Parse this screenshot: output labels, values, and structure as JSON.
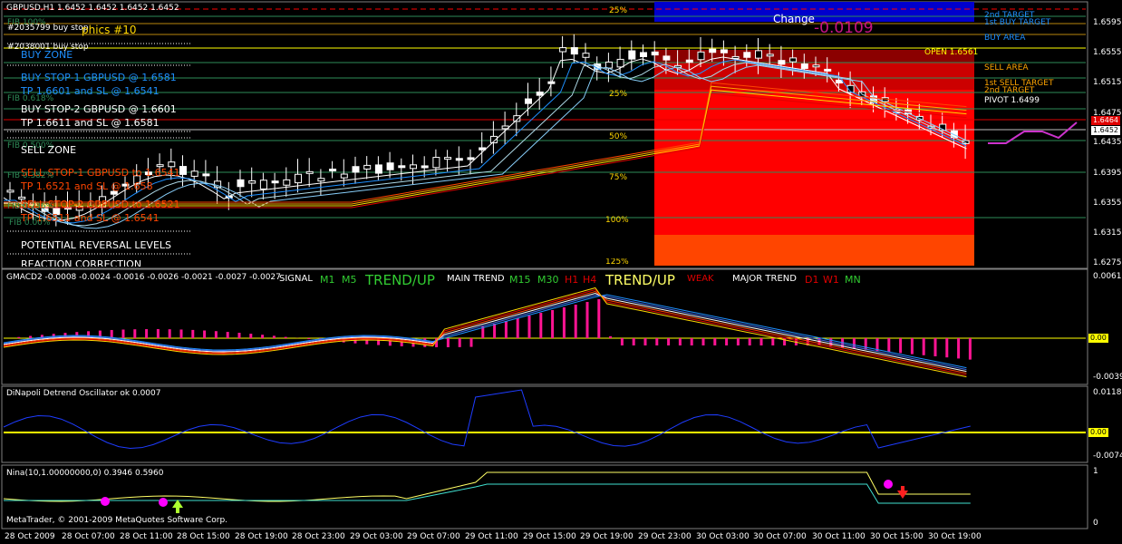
{
  "window": {
    "symbol_header": "GBPUSD,H1  1.6452 1.6452 1.6452 1.6452",
    "copyright": "MetaTrader, © 2001-2009 MetaQuotes Software Corp."
  },
  "overlays": {
    "fib_100": "FIB 100%",
    "order1": "#2035799 buy stop",
    "graphics_title": "phics #10",
    "order2": "#2038001 buy stop",
    "buy_zone": "BUY ZONE",
    "buy_stop1": "BUY STOP-1  GBPUSD  @  1.6581",
    "tp1": "TP 1.6601  and SL @  1.6541",
    "fib_618": "FIB 0.618%",
    "buy_stop2": "BUY STOP-2  GBPUSD  @  1.6601",
    "tp2": "TP 1.6611  and SL @  1.6581",
    "fib_500": "FIB 0.500%",
    "sell_zone": "SELL ZONE",
    "sell_stop1": "SELL STOP-1  GBPUSD  to  1.6541",
    "fib_382": "FIB 0.382%",
    "tp3": "TP 1.6521  and SL @  1.658",
    "sell_stop2": "SELL STOP-2  GBPUSD  to  1.6521",
    "fib_236": "FIB 0.236%",
    "tp4": "TP 1.6511  and SL @  1.6541",
    "fib_000": "FIB 0.00%",
    "reversal": "POTENTIAL REVERSAL LEVELS",
    "reaction": "REACTION CORRECTION"
  },
  "fib_levels": {
    "p25_top": "25%",
    "p25": "25%",
    "p50": "50%",
    "p75": "75%",
    "p100": "100%",
    "p125": "125%"
  },
  "right_panel": {
    "change_label": "Change",
    "change_value": "-0.0109",
    "target2": "2nd TARGET",
    "target1_buy": "1st BUY TARGET",
    "buy_area": "BUY AREA",
    "open": "OPEN 1.6561",
    "sell_area": "SELL AREA",
    "sell_target1": "1st SELL TARGET",
    "sell_target2": "2nd TARGET",
    "pivot": "PIVOT 1.6499"
  },
  "price_axis": {
    "labels": [
      "1.6595",
      "1.6555",
      "1.6515",
      "1.6475",
      "1.6435",
      "1.6395",
      "1.6355",
      "1.6315",
      "1.6275"
    ],
    "tag_red": "1.6464",
    "tag_current": "1.6452"
  },
  "macd_panel": {
    "header": "GMACD2 -0.0008 -0.0024 -0.0016 -0.0026 -0.0021 -0.0027 -0.0027",
    "signal": "SIGNAL",
    "m1": "M1",
    "m5": "M5",
    "trend1": "TREND/UP",
    "main_trend": "MAIN TREND",
    "m15": "M15",
    "m30": "M30",
    "h1": "H1",
    "h4": "H4",
    "trend2": "TREND/UP",
    "weak": "WEAK",
    "major_trend": "MAJOR TREND",
    "d1": "D1",
    "w1": "W1",
    "mn": "MN",
    "axis_top": "0.0061",
    "axis_zero": "0.00",
    "axis_bottom": "-0.0039"
  },
  "dinapoli_panel": {
    "header": "DiNapoli Detrend Oscillator ok  0.0007",
    "axis_top": "0.0118",
    "axis_zero": "0.00",
    "axis_bottom": "-0.0074"
  },
  "nina_panel": {
    "header": "Nina(10,1.00000000,0) 0.3946 0.5960",
    "axis_top": "1",
    "axis_bottom": "0"
  },
  "time_axis": [
    "28 Oct 2009",
    "28 Oct 07:00",
    "28 Oct 11:00",
    "28 Oct 15:00",
    "28 Oct 19:00",
    "28 Oct 23:00",
    "29 Oct 03:00",
    "29 Oct 07:00",
    "29 Oct 11:00",
    "29 Oct 15:00",
    "29 Oct 19:00",
    "29 Oct 23:00",
    "30 Oct 03:00",
    "30 Oct 07:00",
    "30 Oct 11:00",
    "30 Oct 15:00",
    "30 Oct 19:00"
  ],
  "colors": {
    "background": "#000000",
    "grid": "#1f6b1f",
    "bull": "#ffffff",
    "bear": "#000000",
    "sell_zone": "#ff0000",
    "sell_zone_low": "#ff4500",
    "buy_zone": "#0000cd",
    "histogram": "#ff1493",
    "zero_line": "#ffff00"
  }
}
